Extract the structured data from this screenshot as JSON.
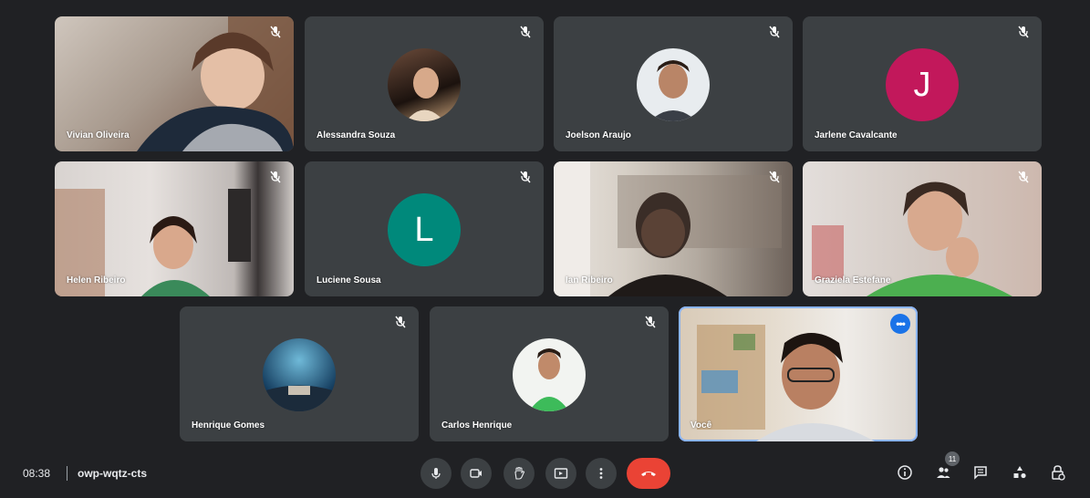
{
  "participants": [
    {
      "name": "Vivian Oliveira",
      "type": "video",
      "muted": true
    },
    {
      "name": "Alessandra Souza",
      "type": "photo",
      "muted": true
    },
    {
      "name": "Joelson Araujo",
      "type": "photo",
      "muted": true
    },
    {
      "name": "Jarlene Cavalcante",
      "type": "initial",
      "initial": "J",
      "color": "#c2185b",
      "muted": true
    },
    {
      "name": "Helen Ribeiro",
      "type": "video",
      "muted": true
    },
    {
      "name": "Luciene Sousa",
      "type": "initial",
      "initial": "L",
      "color": "#00897b",
      "muted": true
    },
    {
      "name": "Ian Ribeiro",
      "type": "video",
      "muted": true
    },
    {
      "name": "Graziela Estefane",
      "type": "video",
      "muted": true
    },
    {
      "name": "Henrique Gomes",
      "type": "photo",
      "muted": true
    },
    {
      "name": "Carlos Henrique",
      "type": "photo",
      "muted": true
    },
    {
      "name": "Você",
      "type": "video",
      "self": true,
      "more_label": "•••"
    }
  ],
  "meeting": {
    "time": "08:38",
    "code": "owp-wqtz-cts"
  },
  "controls": {
    "center": [
      "microphone-icon",
      "camera-icon",
      "raise-hand-icon",
      "present-screen-icon",
      "more-options-icon",
      "end-call-icon"
    ],
    "right": [
      "meeting-details-icon",
      "people-icon",
      "chat-icon",
      "activities-icon",
      "host-controls-icon"
    ],
    "people_badge": "11"
  },
  "colors": {
    "background": "#202124",
    "tile": "#3c4043",
    "end_call": "#ea4335",
    "self_highlight": "#8ab4f8"
  }
}
